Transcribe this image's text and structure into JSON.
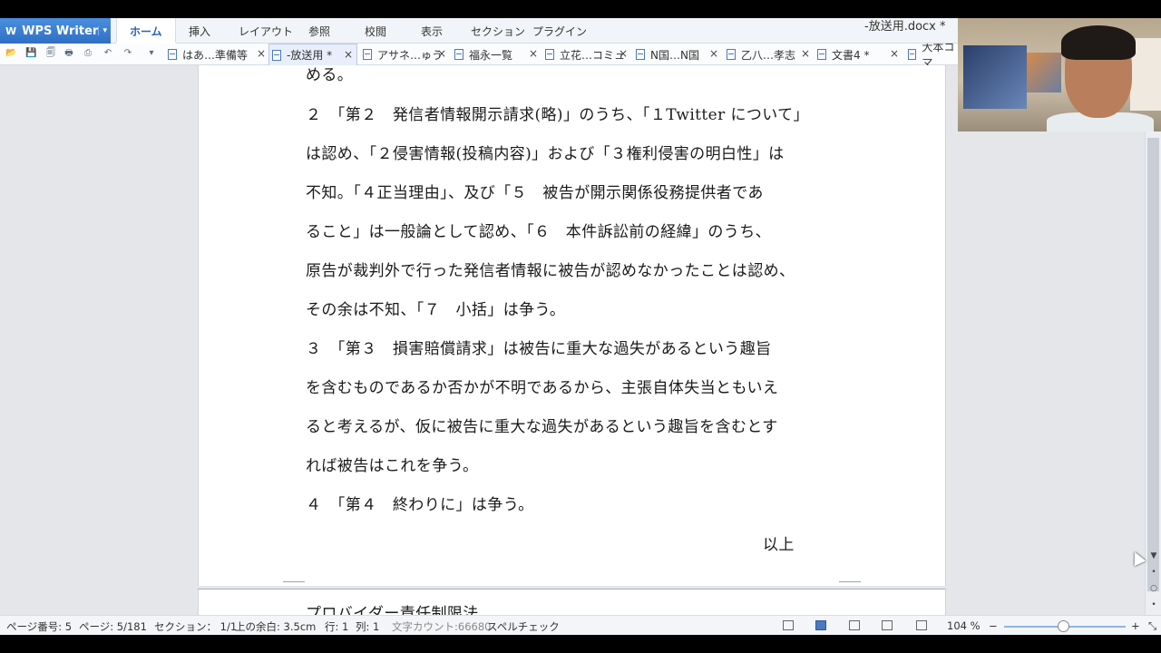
{
  "app": {
    "name": "WPS Writer",
    "logo_glyph": "W",
    "caret_glyph": "▾",
    "document_title": "-放送用.docx *"
  },
  "menu": {
    "tabs": [
      "ホーム",
      "挿入",
      "レイアウト",
      "参照",
      "校閲",
      "表示",
      "セクション",
      "プラグイン"
    ],
    "active_index": 0
  },
  "toolbar": {
    "icons": [
      "open-folder-icon",
      "save-icon",
      "print-preview-icon",
      "print-icon",
      "export-icon",
      "undo-icon",
      "redo-icon",
      "more-icon"
    ],
    "glyphs": [
      "📂",
      "💾",
      "🗐",
      "🖶",
      "⎙",
      "↶",
      "↷",
      "▾"
    ]
  },
  "doc_tabs": [
    {
      "label": "はあ…準備等",
      "active": false
    },
    {
      "label": "-放送用 *",
      "active": true
    },
    {
      "label": "アサネ…ゅう",
      "active": false
    },
    {
      "label": "福永一覧",
      "active": false
    },
    {
      "label": "立花…コミュ",
      "active": false
    },
    {
      "label": "N国…N国",
      "active": false
    },
    {
      "label": "乙八…孝志",
      "active": false
    },
    {
      "label": "文書4 *",
      "active": false
    },
    {
      "label": "大本コマ",
      "active": false
    }
  ],
  "document": {
    "lines": [
      "める。",
      "２　「第２　発信者情報開示請求(略)」のうち、「１Twitter について」",
      "は認め、「２侵害情報(投稿内容)」および「３権利侵害の明白性」は",
      "不知。「４正当理由」、及び「５　被告が開示関係役務提供者であ",
      "ること」は一般論として認め、「６　本件訴訟前の経緯」のうち、",
      "原告が裁判外で行った発信者情報に被告が認めなかったことは認め、",
      "その余は不知、「７　小括」は争う。",
      "３　「第３　損害賠償請求」は被告に重大な過失があるという趣旨",
      "を含むものであるか否かが不明であるから、主張自体失当ともいえ",
      "ると考えるが、仮に被告に重大な過失があるという趣旨を含むとす",
      "れば被告はこれを争う。",
      "４　「第４　終わりに」は争う。"
    ],
    "closing": "以上",
    "next_page_heading": "プロバイダー責任制限法"
  },
  "statusbar": {
    "page_number": "ページ番号: 5",
    "pages": "ページ: 5/181",
    "section": "セクション： 1/1",
    "top_margin": "上の余白: 3.5cm",
    "row": "行: 1",
    "col": "列: 1",
    "word_count": "文字カウント:66680",
    "spellcheck": "スペルチェック",
    "zoom": "104 %",
    "zoom_minus": "−",
    "zoom_plus": "+",
    "zoom_level": 0.55
  },
  "scrollbar": {
    "glyphs": [
      "▼",
      "•",
      "○",
      "•"
    ]
  }
}
